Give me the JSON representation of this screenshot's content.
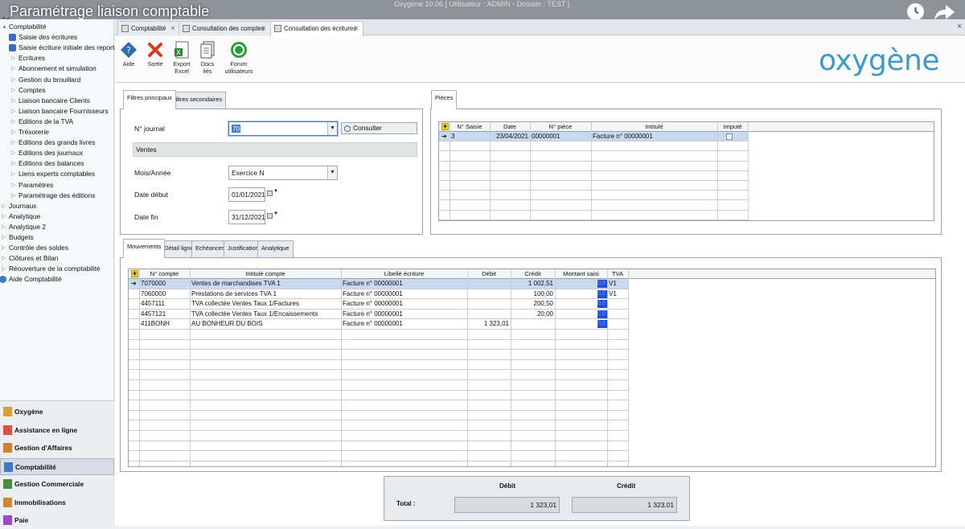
{
  "video": {
    "title": "Paramétrage liaison comptable",
    "window_title": "Oxygène 10.06 [ Utilisateur : ADMIN - Dossier : TEST ]",
    "app_fragment": "Ad"
  },
  "sidebar": {
    "items": [
      {
        "label": "Comptabilité",
        "level": 0,
        "expander": "▲"
      },
      {
        "label": "Saisie des écritures",
        "level": 1,
        "icon": "doc-icon"
      },
      {
        "label": "Saisie écriture initiale des reports",
        "level": 1,
        "icon": "doc-icon"
      },
      {
        "label": "Ecritures",
        "level": 1,
        "expander": "▷"
      },
      {
        "label": "Abonnement et simulation",
        "level": 1,
        "expander": "▷"
      },
      {
        "label": "Gestion du brouillard",
        "level": 1,
        "expander": "▷"
      },
      {
        "label": "Comptes",
        "level": 1,
        "expander": "▷"
      },
      {
        "label": "Liaison bancaire Clients",
        "level": 1,
        "expander": "▷"
      },
      {
        "label": "Liaison bancaire Fournisseurs",
        "level": 1,
        "expander": "▷"
      },
      {
        "label": "Editions de la TVA",
        "level": 1,
        "expander": "▷"
      },
      {
        "label": "Trésorerie",
        "level": 1,
        "expander": "▷"
      },
      {
        "label": "Editions des grands livres",
        "level": 1,
        "expander": "▷"
      },
      {
        "label": "Editions des journaux",
        "level": 1,
        "expander": "▷"
      },
      {
        "label": "Editions des balances",
        "level": 1,
        "expander": "▷"
      },
      {
        "label": "Liens experts comptables",
        "level": 1,
        "expander": "▷"
      },
      {
        "label": "Paramètres",
        "level": 1,
        "expander": "▷"
      },
      {
        "label": "Paramétrage des éditions",
        "level": 1,
        "expander": "▷"
      },
      {
        "label": "Journaux",
        "level": 0,
        "expander": "▷"
      },
      {
        "label": "Analytique",
        "level": 0,
        "expander": "▷"
      },
      {
        "label": "Analytique 2",
        "level": 0,
        "expander": "▷"
      },
      {
        "label": "Budgets",
        "level": 0,
        "expander": "▷"
      },
      {
        "label": "Contrôle des soldes",
        "level": 0,
        "expander": "▷"
      },
      {
        "label": "Clôtures et Bilan",
        "level": 0,
        "expander": "▷"
      },
      {
        "label": "Réouverture de la comptabilité",
        "level": 0,
        "expander": "▷"
      },
      {
        "label": "Aide Comptabilité",
        "level": 0,
        "icon": "help-icon"
      }
    ],
    "modules": [
      {
        "label": "Oxygène",
        "active": false
      },
      {
        "label": "Assistance en ligne",
        "active": false
      },
      {
        "label": "Gestion d'Affaires",
        "active": false
      },
      {
        "label": "Comptabilité",
        "active": true
      },
      {
        "label": "Gestion Commerciale",
        "active": false
      },
      {
        "label": "Immobilisations",
        "active": false
      },
      {
        "label": "Paie",
        "active": false
      }
    ]
  },
  "tabs": [
    {
      "label": "Comptabilité",
      "active": false
    },
    {
      "label": "Consultation des comptes",
      "active": false
    },
    {
      "label": "Consultation des écritures",
      "active": true
    }
  ],
  "toolbar": {
    "help": "Aide",
    "exit": "Sortie",
    "export_l1": "Export",
    "export_l2": "Excel",
    "docs_l1": "Docs",
    "docs_l2": "liés",
    "forum_l1": "Forum",
    "forum_l2": "utilisateurs",
    "logo": "oxygène"
  },
  "filters": {
    "tabs": [
      "Filtres principaux",
      "Filtres secondaires"
    ],
    "journal_label": "N° journal",
    "journal_value": "70",
    "consult_button": "Consulter",
    "journal_name": "Ventes",
    "period_label": "Mois/Année",
    "period_value": "Exercice N",
    "start_label": "Date début",
    "start_value": "01/01/2021",
    "end_label": "Date fin",
    "end_value": "31/12/2021"
  },
  "pieces": {
    "tab": "Pièces",
    "columns": [
      "N° Saisie",
      "Date",
      "N° pièce",
      "Intitulé",
      "Imputé"
    ],
    "rows": [
      {
        "saisie": "3",
        "date": "23/04/2021",
        "piece": "00000001",
        "intitule": "Facture n° 00000001",
        "impute": ""
      }
    ]
  },
  "movements": {
    "tabs": [
      "Mouvements",
      "Détail ligne",
      "Echéances",
      "Justification",
      "Analytique"
    ],
    "columns": [
      "N° compte",
      "Intitulé compte",
      "Libellé écriture",
      "Débit",
      "Crédit",
      "Montant saisi",
      "TVA"
    ],
    "rows": [
      {
        "compte": "7070000",
        "intitule": "Ventes de marchandises TVA 1",
        "libelle": "Facture n° 00000001",
        "debit": "",
        "credit": "1 002,51",
        "saisi": "0,0",
        "tva": "V1"
      },
      {
        "compte": "7060000",
        "intitule": "Prestations de services TVA 1",
        "libelle": "Facture n° 00000001",
        "debit": "",
        "credit": "100,00",
        "saisi": "0,0",
        "tva": "V1"
      },
      {
        "compte": "4457111",
        "intitule": "TVA collectée Ventes Taux 1/Factures",
        "libelle": "Facture n° 00000001",
        "debit": "",
        "credit": "200,50",
        "saisi": "0,0",
        "tva": ""
      },
      {
        "compte": "4457121",
        "intitule": "TVA collectée Ventes Taux 1/Encaissements",
        "libelle": "Facture n° 00000001",
        "debit": "",
        "credit": "20,00",
        "saisi": "0,0",
        "tva": ""
      },
      {
        "compte": "411BONH",
        "intitule": "AU BONHEUR DU BOIS",
        "libelle": "Facture n° 00000001",
        "debit": "1 323,01",
        "credit": "",
        "saisi": "0,0",
        "tva": ""
      }
    ]
  },
  "totals": {
    "label": "Total :",
    "debit_header": "Débit",
    "credit_header": "Crédit",
    "debit": "1 323,01",
    "credit": "1 323,01"
  }
}
